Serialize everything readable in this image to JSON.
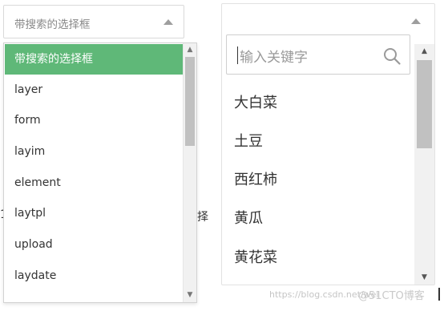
{
  "left_select": {
    "value": "带搜索的选择框",
    "options": [
      "带搜索的选择框",
      "layer",
      "form",
      "layim",
      "element",
      "laytpl",
      "upload",
      "laydate"
    ],
    "selected_index": 0,
    "scroll_position": 0
  },
  "right_select": {
    "value": "",
    "search_placeholder": "输入关键字",
    "options": [
      "大白菜",
      "土豆",
      "西红柿",
      "黄瓜",
      "黄花菜"
    ],
    "scroll_position": 0
  },
  "background_fragments": {
    "right_edge_char": "择",
    "left_edge_char": "1"
  },
  "footer": {
    "watermark": "https://blog.csdn.net/wei",
    "brand": "@51CTO博客"
  },
  "colors": {
    "accent": "#5fb878",
    "border": "#d9d9d9",
    "scrollbar_track": "#f1f1f1",
    "scrollbar_thumb": "#c1c1c1"
  },
  "icons": {
    "select_arrow": "triangle-up-icon",
    "search": "search-icon"
  }
}
